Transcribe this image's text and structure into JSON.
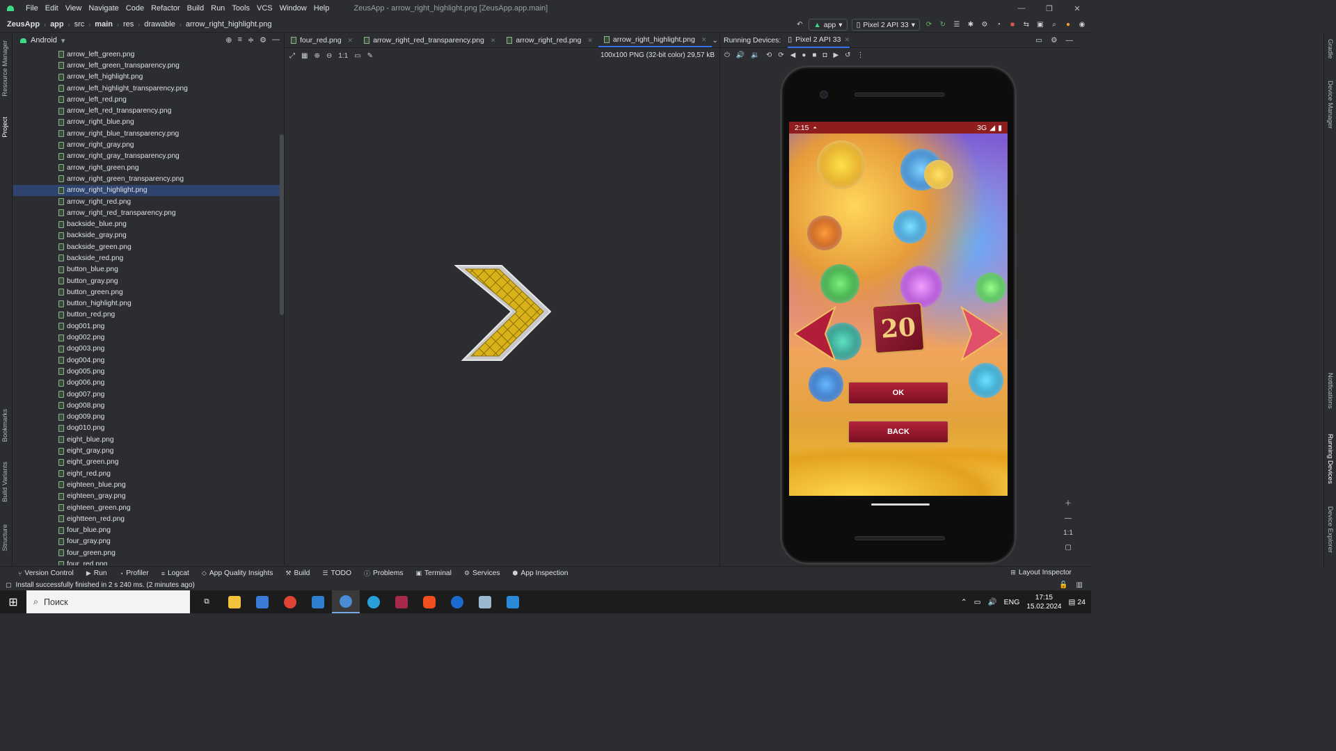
{
  "window": {
    "title": "ZeusApp - arrow_right_highlight.png [ZeusApp.app.main]",
    "menu": [
      "File",
      "Edit",
      "View",
      "Navigate",
      "Code",
      "Refactor",
      "Build",
      "Run",
      "Tools",
      "VCS",
      "Window",
      "Help"
    ]
  },
  "breadcrumb": [
    "ZeusApp",
    "app",
    "src",
    "main",
    "res",
    "drawable",
    "arrow_right_highlight.png"
  ],
  "run_config": {
    "module": "app",
    "device": "Pixel 2 API 33"
  },
  "project": {
    "view": "Android",
    "files": [
      "arrow_left_green.png",
      "arrow_left_green_transparency.png",
      "arrow_left_highlight.png",
      "arrow_left_highlight_transparency.png",
      "arrow_left_red.png",
      "arrow_left_red_transparency.png",
      "arrow_right_blue.png",
      "arrow_right_blue_transparency.png",
      "arrow_right_gray.png",
      "arrow_right_gray_transparency.png",
      "arrow_right_green.png",
      "arrow_right_green_transparency.png",
      "arrow_right_highlight.png",
      "arrow_right_red.png",
      "arrow_right_red_transparency.png",
      "backside_blue.png",
      "backside_gray.png",
      "backside_green.png",
      "backside_red.png",
      "button_blue.png",
      "button_gray.png",
      "button_green.png",
      "button_highlight.png",
      "button_red.png",
      "dog001.png",
      "dog002.png",
      "dog003.png",
      "dog004.png",
      "dog005.png",
      "dog006.png",
      "dog007.png",
      "dog008.png",
      "dog009.png",
      "dog010.png",
      "eight_blue.png",
      "eight_gray.png",
      "eight_green.png",
      "eight_red.png",
      "eighteen_blue.png",
      "eighteen_gray.png",
      "eighteen_green.png",
      "eightteen_red.png",
      "four_blue.png",
      "four_gray.png",
      "four_green.png",
      "four_red.png"
    ],
    "selected_file": "arrow_right_highlight.png"
  },
  "editor": {
    "tabs": [
      "four_red.png",
      "arrow_right_red_transparency.png",
      "arrow_right_red.png",
      "arrow_right_highlight.png"
    ],
    "active_tab": "arrow_right_highlight.png",
    "image_info": "100x100 PNG (32-bit color) 29,57 kB",
    "zoom_actual": "1:1"
  },
  "running_devices": {
    "label": "Running Devices:",
    "device_tab": "Pixel 2 API 33",
    "status_time": "2:15",
    "status_network": "3G",
    "game": {
      "dice_value": "20",
      "ok_label": "OK",
      "back_label": "BACK"
    },
    "zoom_actual": "1:1"
  },
  "side_labels": {
    "left": [
      "Resource Manager",
      "Project",
      "Bookmarks",
      "Build Variants",
      "Structure"
    ],
    "right": [
      "Gradle",
      "Device Manager",
      "Notifications",
      "Running Devices",
      "Device Explorer"
    ]
  },
  "tool_windows": [
    "Version Control",
    "Run",
    "Profiler",
    "Logcat",
    "App Quality Insights",
    "Build",
    "TODO",
    "Problems",
    "Terminal",
    "Services",
    "App Inspection"
  ],
  "layout_inspector": "Layout Inspector",
  "status_message": "Install successfully finished in 2 s 240 ms. (2 minutes ago)",
  "taskbar": {
    "search_placeholder": "Поиск",
    "language": "ENG",
    "time": "17:15",
    "date": "15.02.2024",
    "notifications": "24"
  },
  "colors": {
    "ide_bg": "#2b2d30",
    "selection": "#2e436e",
    "accent": "#3574f0",
    "arrow_gold": "#d9b21a",
    "status_red": "#8f1d1d"
  }
}
